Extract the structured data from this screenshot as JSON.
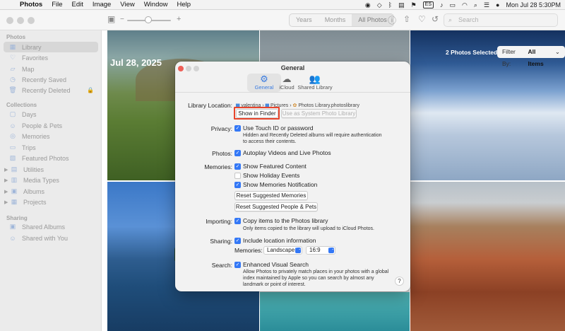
{
  "menubar": {
    "app": "Photos",
    "items": [
      "File",
      "Edit",
      "Image",
      "View",
      "Window",
      "Help"
    ],
    "status": {
      "datetime": "Mon Jul 28  5:30PM",
      "keyboard": "ES"
    }
  },
  "toolbar": {
    "segments": [
      "Years",
      "Months",
      "All Photos"
    ],
    "active_segment": "All Photos",
    "search_placeholder": "Search"
  },
  "sidebar": {
    "sections": [
      {
        "title": "Photos",
        "items": [
          {
            "label": "Library",
            "icon": "library-icon",
            "selected": true
          },
          {
            "label": "Favorites",
            "icon": "heart-icon"
          },
          {
            "label": "Map",
            "icon": "map-icon"
          },
          {
            "label": "Recently Saved",
            "icon": "clock-icon"
          },
          {
            "label": "Recently Deleted",
            "icon": "trash-icon",
            "locked": true
          }
        ]
      },
      {
        "title": "Collections",
        "items": [
          {
            "label": "Days",
            "icon": "calendar-icon"
          },
          {
            "label": "People & Pets",
            "icon": "person-icon"
          },
          {
            "label": "Memories",
            "icon": "memories-icon"
          },
          {
            "label": "Trips",
            "icon": "suitcase-icon"
          },
          {
            "label": "Featured Photos",
            "icon": "featured-icon"
          },
          {
            "label": "Utilities",
            "icon": "utilities-icon",
            "expandable": true
          },
          {
            "label": "Media Types",
            "icon": "media-types-icon",
            "expandable": true
          },
          {
            "label": "Albums",
            "icon": "albums-icon",
            "expandable": true
          },
          {
            "label": "Projects",
            "icon": "projects-icon",
            "expandable": true
          }
        ]
      },
      {
        "title": "Sharing",
        "items": [
          {
            "label": "Shared Albums",
            "icon": "shared-albums-icon"
          },
          {
            "label": "Shared with You",
            "icon": "shared-with-you-icon"
          }
        ]
      }
    ]
  },
  "grid": {
    "date": "Jul 28, 2025",
    "selection_count": "2 Photos Selected",
    "filter_label": "Filter By:",
    "filter_value": "All Items"
  },
  "dialog": {
    "title": "General",
    "tabs": [
      "General",
      "iCloud",
      "Shared Library"
    ],
    "active_tab": "General",
    "library_location": {
      "label": "Library Location:",
      "path": [
        "valentina",
        "Pictures",
        "Photos Library.photoslibrary"
      ],
      "show_in_finder": "Show in Finder",
      "use_as_system": "Use as System Photo Library"
    },
    "privacy": {
      "label": "Privacy:",
      "option": "Use Touch ID or password",
      "checked": true,
      "note": "Hidden and Recently Deleted albums will require authentication to access their contents."
    },
    "photos": {
      "label": "Photos:",
      "option": "Autoplay Videos and Live Photos",
      "checked": true
    },
    "memories": {
      "label": "Memories:",
      "options": [
        {
          "text": "Show Featured Content",
          "checked": true
        },
        {
          "text": "Show Holiday Events",
          "checked": false
        },
        {
          "text": "Show Memories Notification",
          "checked": true
        }
      ],
      "reset_memories": "Reset Suggested Memories",
      "reset_people": "Reset Suggested People & Pets"
    },
    "importing": {
      "label": "Importing:",
      "option": "Copy items to the Photos library",
      "checked": true,
      "note": "Only items copied to the library will upload to iCloud Photos."
    },
    "sharing": {
      "label": "Sharing:",
      "option": "Include location information",
      "checked": true,
      "memories_label": "Memories:",
      "orientation": "Landscape",
      "aspect": "16:9"
    },
    "search": {
      "label": "Search:",
      "option": "Enhanced Visual Search",
      "checked": true,
      "note": "Allow Photos to privately match places in your photos with a global index maintained by Apple so you can search by almost any landmark or point of interest."
    },
    "help": "?"
  },
  "colors": {
    "accent": "#3478f6",
    "highlight": "#e8452c"
  }
}
